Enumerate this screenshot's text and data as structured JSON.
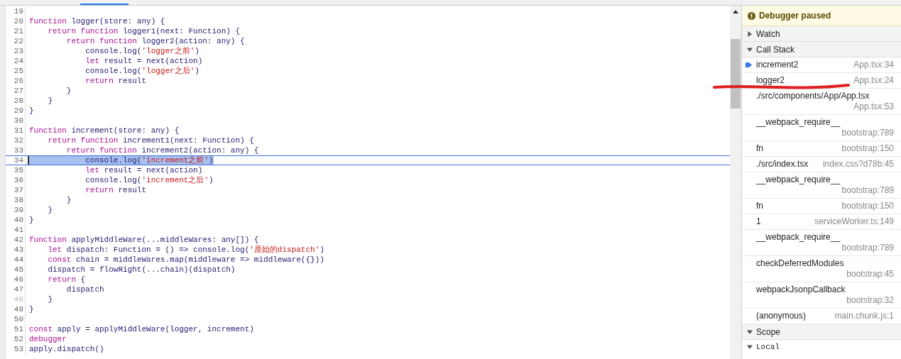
{
  "editor": {
    "lines": [
      {
        "num": "19",
        "current": false,
        "greyed": false
      },
      {
        "num": "20",
        "current": false,
        "greyed": false,
        "segments": [
          {
            "kind": "kw",
            "text": "function"
          },
          {
            "kind": "id",
            "text": " logger(store: any) {"
          }
        ]
      },
      {
        "num": "21",
        "current": false,
        "greyed": false,
        "segments": [
          {
            "kind": "kw",
            "text": "    return function"
          },
          {
            "kind": "id",
            "text": " logger1(next: Function) {"
          }
        ]
      },
      {
        "num": "22",
        "current": false,
        "greyed": false,
        "segments": [
          {
            "kind": "kw",
            "text": "        return function"
          },
          {
            "kind": "id",
            "text": " logger2(action: any) {"
          }
        ]
      },
      {
        "num": "23",
        "current": false,
        "greyed": false,
        "segments": [
          {
            "kind": "id",
            "text": "            console.log("
          },
          {
            "kind": "str",
            "text": "'logger之前'"
          },
          {
            "kind": "id",
            "text": ")"
          }
        ]
      },
      {
        "num": "24",
        "current": false,
        "greyed": false,
        "segments": [
          {
            "kind": "kw",
            "text": "            let"
          },
          {
            "kind": "id",
            "text": " result = next(action)"
          }
        ]
      },
      {
        "num": "25",
        "current": false,
        "greyed": false,
        "segments": [
          {
            "kind": "id",
            "text": "            console.log("
          },
          {
            "kind": "str",
            "text": "'logger之后'"
          },
          {
            "kind": "id",
            "text": ")"
          }
        ]
      },
      {
        "num": "26",
        "current": false,
        "greyed": false,
        "segments": [
          {
            "kind": "kw",
            "text": "            return"
          },
          {
            "kind": "id",
            "text": " result"
          }
        ]
      },
      {
        "num": "27",
        "current": false,
        "greyed": false,
        "segments": [
          {
            "kind": "id",
            "text": "        }"
          }
        ]
      },
      {
        "num": "28",
        "current": false,
        "greyed": false,
        "segments": [
          {
            "kind": "id",
            "text": "    }"
          }
        ]
      },
      {
        "num": "29",
        "current": false,
        "greyed": false,
        "segments": [
          {
            "kind": "id",
            "text": "}"
          }
        ]
      },
      {
        "num": "30",
        "current": false,
        "greyed": false
      },
      {
        "num": "31",
        "current": false,
        "greyed": false,
        "segments": [
          {
            "kind": "kw",
            "text": "function"
          },
          {
            "kind": "id",
            "text": " increment(store: any) {"
          }
        ]
      },
      {
        "num": "32",
        "current": false,
        "greyed": false,
        "segments": [
          {
            "kind": "kw",
            "text": "    return function"
          },
          {
            "kind": "id",
            "text": " increment1(next: Function) {"
          }
        ]
      },
      {
        "num": "33",
        "current": false,
        "greyed": false,
        "segments": [
          {
            "kind": "kw",
            "text": "        return function"
          },
          {
            "kind": "id",
            "text": " increment2(action: any) {"
          }
        ]
      },
      {
        "num": "34",
        "current": true,
        "greyed": false,
        "segments": [
          {
            "kind": "id",
            "text": "            console.log("
          },
          {
            "kind": "str",
            "text": "'increment之前'"
          },
          {
            "kind": "id",
            "text": ")"
          }
        ]
      },
      {
        "num": "35",
        "current": false,
        "greyed": false,
        "segments": [
          {
            "kind": "kw",
            "text": "            let"
          },
          {
            "kind": "id",
            "text": " result = next(action)"
          }
        ]
      },
      {
        "num": "36",
        "current": false,
        "greyed": false,
        "segments": [
          {
            "kind": "id",
            "text": "            console.log("
          },
          {
            "kind": "str",
            "text": "'increment之后'"
          },
          {
            "kind": "id",
            "text": ")"
          }
        ]
      },
      {
        "num": "37",
        "current": false,
        "greyed": false,
        "segments": [
          {
            "kind": "kw",
            "text": "            return"
          },
          {
            "kind": "id",
            "text": " result"
          }
        ]
      },
      {
        "num": "38",
        "current": false,
        "greyed": false,
        "segments": [
          {
            "kind": "id",
            "text": "        }"
          }
        ]
      },
      {
        "num": "39",
        "current": false,
        "greyed": false,
        "segments": [
          {
            "kind": "id",
            "text": "    }"
          }
        ]
      },
      {
        "num": "40",
        "current": false,
        "greyed": false,
        "segments": [
          {
            "kind": "id",
            "text": "}"
          }
        ]
      },
      {
        "num": "41",
        "current": false,
        "greyed": false
      },
      {
        "num": "42",
        "current": false,
        "greyed": false,
        "segments": [
          {
            "kind": "kw",
            "text": "function"
          },
          {
            "kind": "id",
            "text": " applyMiddleWare(...middleWares: any[]) {"
          }
        ]
      },
      {
        "num": "43",
        "current": false,
        "greyed": false,
        "segments": [
          {
            "kind": "kw",
            "text": "    let"
          },
          {
            "kind": "id",
            "text": " dispatch: Function = () => console.log("
          },
          {
            "kind": "str",
            "text": "'原始的dispatch'"
          },
          {
            "kind": "id",
            "text": ")"
          }
        ]
      },
      {
        "num": "44",
        "current": false,
        "greyed": false,
        "segments": [
          {
            "kind": "kw",
            "text": "    const"
          },
          {
            "kind": "id",
            "text": " chain = middleWares.map(middleware => middleware({}))"
          }
        ]
      },
      {
        "num": "45",
        "current": false,
        "greyed": false,
        "segments": [
          {
            "kind": "id",
            "text": "    dispatch = flowRight(...chain)(dispatch)"
          }
        ]
      },
      {
        "num": "46",
        "current": false,
        "greyed": false,
        "segments": [
          {
            "kind": "kw",
            "text": "    return"
          },
          {
            "kind": "id",
            "text": " {"
          }
        ]
      },
      {
        "num": "47",
        "current": false,
        "greyed": false,
        "segments": [
          {
            "kind": "id",
            "text": "        dispatch"
          }
        ]
      },
      {
        "num": "48",
        "current": false,
        "greyed": true,
        "segments": [
          {
            "kind": "id",
            "text": "    }"
          }
        ]
      },
      {
        "num": "49",
        "current": false,
        "greyed": false,
        "segments": [
          {
            "kind": "id",
            "text": "}"
          }
        ]
      },
      {
        "num": "50",
        "current": false,
        "greyed": false
      },
      {
        "num": "51",
        "current": false,
        "greyed": false,
        "segments": [
          {
            "kind": "kw",
            "text": "const"
          },
          {
            "kind": "id",
            "text": " apply = applyMiddleWare(logger, increment)"
          }
        ]
      },
      {
        "num": "52",
        "current": false,
        "greyed": false,
        "segments": [
          {
            "kind": "kw",
            "text": "debugger"
          }
        ]
      },
      {
        "num": "53",
        "current": false,
        "greyed": false,
        "segments": [
          {
            "kind": "id",
            "text": "apply.dispatch()"
          }
        ]
      }
    ]
  },
  "sidebar": {
    "banner": "Debugger paused",
    "sections": [
      {
        "title": "Watch",
        "expanded": false
      },
      {
        "title": "Call Stack",
        "expanded": true
      }
    ],
    "frames": [
      {
        "name": "increment2",
        "location": "App.tsx:34",
        "selected": true
      },
      {
        "name": "logger2",
        "location": "App.tsx:24",
        "selected": false
      },
      {
        "name": "./src/components/App/App.tsx",
        "location": "App.tsx:53",
        "selected": false
      },
      {
        "name": "__webpack_require__",
        "location": "bootstrap:789",
        "selected": false
      },
      {
        "name": "fn",
        "location": "bootstrap:150",
        "selected": false
      },
      {
        "name": "./src/index.tsx",
        "location": "index.css?d78b:45",
        "selected": false
      },
      {
        "name": "__webpack_require__",
        "location": "bootstrap:789",
        "selected": false
      },
      {
        "name": "fn",
        "location": "bootstrap:150",
        "selected": false
      },
      {
        "name": "1",
        "location": "serviceWorker.ts:149",
        "selected": false
      },
      {
        "name": "__webpack_require__",
        "location": "bootstrap:789",
        "selected": false
      },
      {
        "name": "checkDeferredModules",
        "location": "bootstrap:45",
        "selected": false
      },
      {
        "name": "webpackJsonpCallback",
        "location": "bootstrap:32",
        "selected": false
      },
      {
        "name": "(anonymous)",
        "location": "main.chunk.js:1",
        "selected": false
      }
    ],
    "scope": {
      "title": "Scope",
      "expanded": true,
      "local": {
        "title": "Local",
        "expanded": true
      }
    }
  }
}
